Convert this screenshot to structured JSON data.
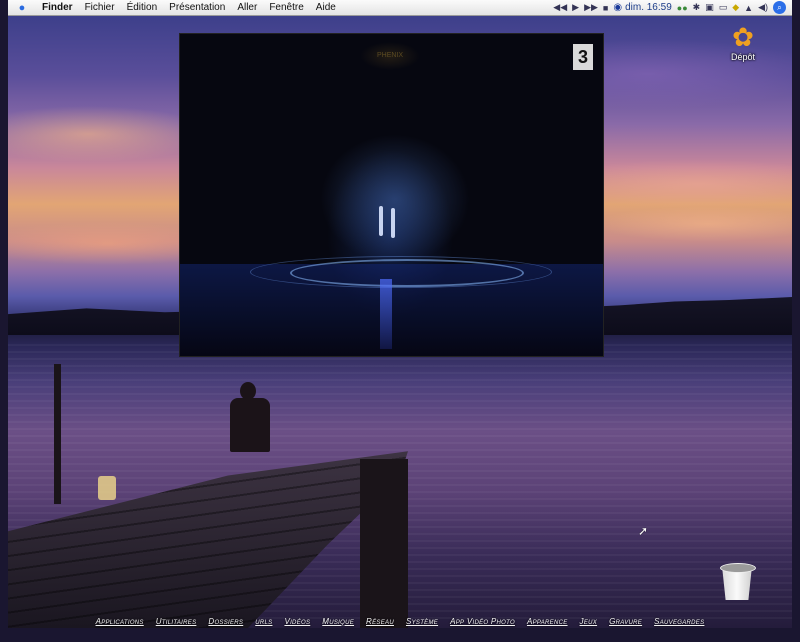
{
  "menubar": {
    "apple_icon": "apple-icon",
    "app": "Finder",
    "items": [
      "Fichier",
      "Édition",
      "Présentation",
      "Aller",
      "Fenêtre",
      "Aide"
    ],
    "clock": "dim. 16:59",
    "status_icons": [
      "media-prev-icon",
      "media-play-icon",
      "media-next-icon",
      "media-stop-icon",
      "bluetooth-icon",
      "wifi-icon",
      "lock-icon",
      "volume-icon",
      "spotlight-icon"
    ]
  },
  "video": {
    "channel": "3",
    "logo": "PHENIX"
  },
  "desktop": {
    "depot_label": "Dépôt"
  },
  "shelf": {
    "labels": [
      "Applications",
      "Utilitaires",
      "Dossiers",
      "urls",
      "Vidéos",
      "Musique",
      "Réseau",
      "Système",
      "App Vidéo Photo",
      "Apparence",
      "Jeux",
      "Gravure",
      "Sauvegardes"
    ]
  }
}
